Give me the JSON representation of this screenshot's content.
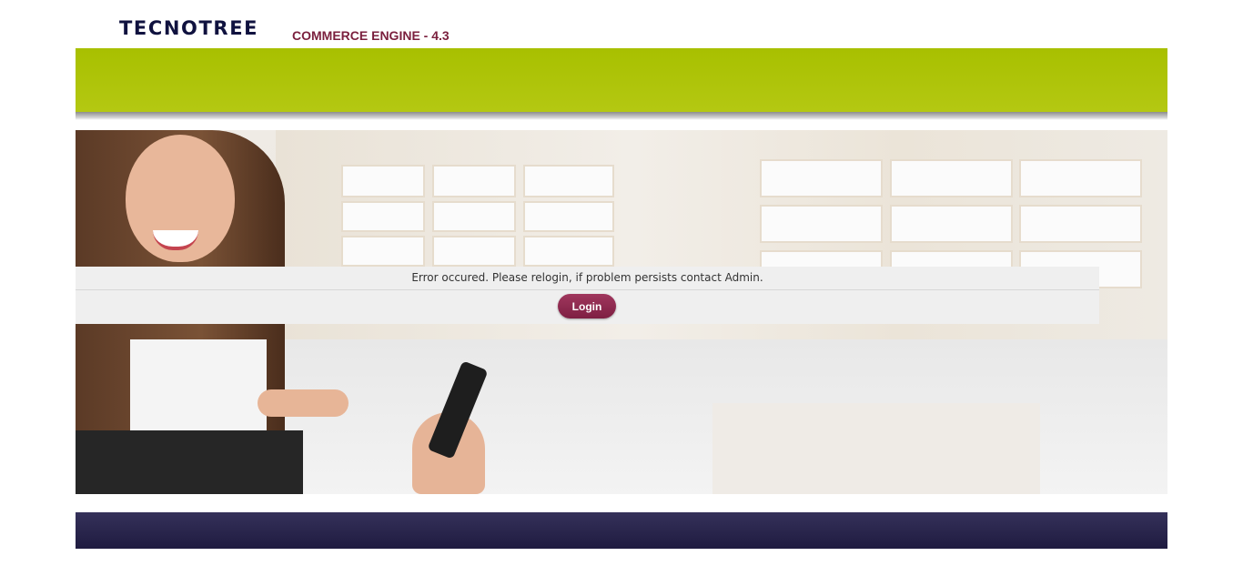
{
  "header": {
    "logo_text": "TECNOTREE",
    "product_text": "COMMERCE ENGINE - 4.3"
  },
  "colors": {
    "brand_green": "#a8c000",
    "brand_maroon": "#7a1f3d",
    "footer_navy": "#2a2650"
  },
  "message_panel": {
    "error_text": "Error occured. Please relogin, if problem persists contact Admin.",
    "login_label": "Login"
  }
}
